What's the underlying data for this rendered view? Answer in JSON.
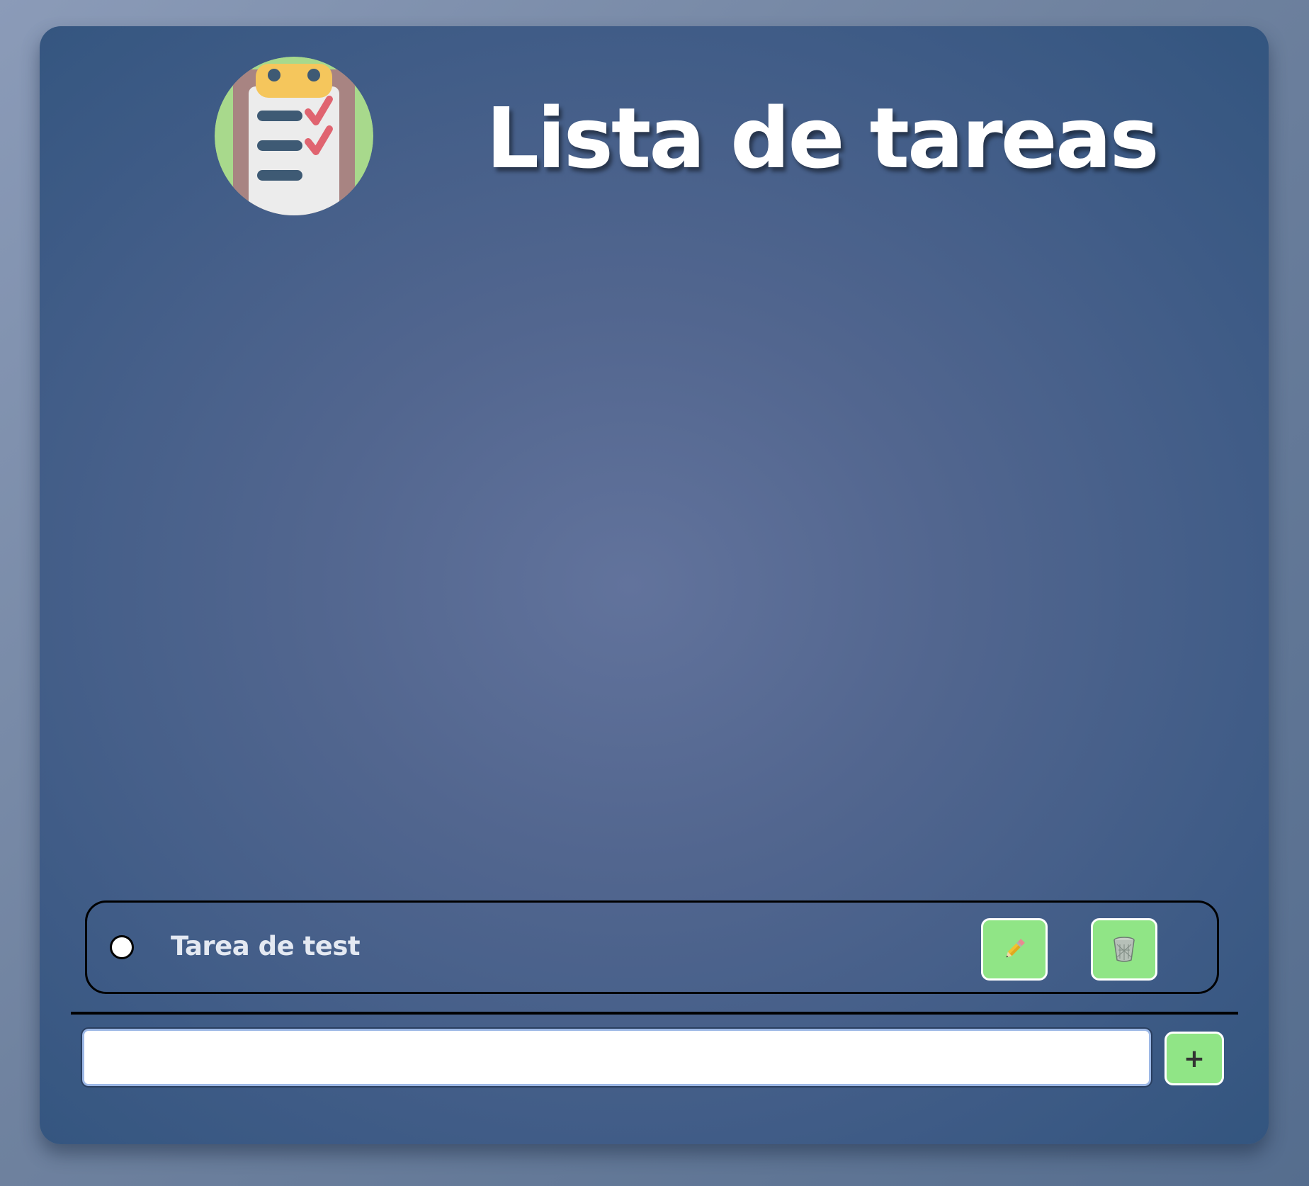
{
  "header": {
    "title": "Lista de tareas",
    "logo_icon": "clipboard-checklist-icon"
  },
  "tasks": [
    {
      "label": "Tarea de test",
      "completed": false,
      "edit_icon": "pencil-icon",
      "delete_icon": "trash-icon"
    }
  ],
  "new_task": {
    "value": "",
    "placeholder": "",
    "add_label": "+"
  },
  "colors": {
    "page_background": "#7a8cab",
    "card_background": "#4a6189",
    "button_green": "#90e586",
    "title_text": "#ffffff",
    "task_text": "#e4e9f2"
  }
}
